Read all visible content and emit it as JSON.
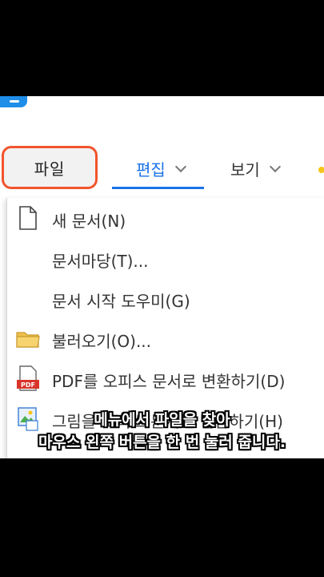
{
  "menubar": {
    "file_label": "파일",
    "edit_label": "편집",
    "view_label": "보기"
  },
  "dropdown": {
    "items": [
      {
        "label": "새 문서(N)",
        "icon": "new-document-icon"
      },
      {
        "label": "문서마당(T)...",
        "icon": ""
      },
      {
        "label": "문서 시작 도우미(G)",
        "icon": ""
      },
      {
        "label": "불러오기(O)...",
        "icon": "folder-icon"
      },
      {
        "label": "PDF를 오피스 문서로 변환하기(D)",
        "icon": "pdf-icon"
      },
      {
        "label": "그림을 오피스 문서로 변환하기(H)",
        "icon": "image-convert-icon"
      }
    ]
  },
  "pdf_icon_text": "PDF",
  "caption": {
    "line1": "메뉴에서 파일을 찾아",
    "line2": "마우스 왼쪽 버튼을 한 번 눌러 줍니다."
  },
  "colors": {
    "highlight_border": "#f2542d",
    "accent": "#1a73e8",
    "background": "#000000"
  }
}
